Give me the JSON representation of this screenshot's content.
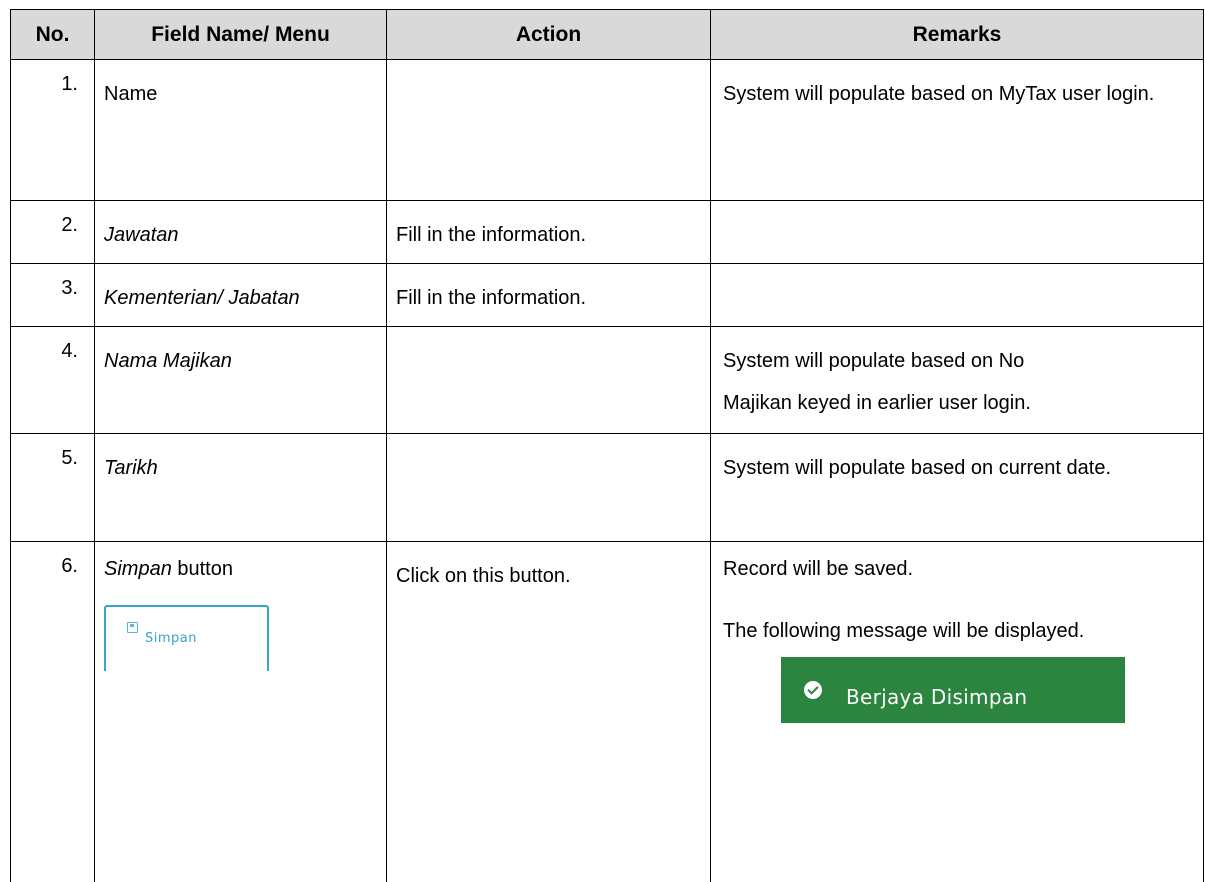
{
  "table": {
    "headers": {
      "no": "No.",
      "field": "Field Name/ Menu",
      "action": "Action",
      "remarks": "Remarks"
    },
    "rows": [
      {
        "no": "1.",
        "field": "Name",
        "action": "",
        "remarks": "System will populate based on MyTax user login."
      },
      {
        "no": "2.",
        "field": "Jawatan",
        "action": "Fill in the information.",
        "remarks": ""
      },
      {
        "no": "3.",
        "field": "Kementerian/ Jabatan",
        "action": "Fill in the information.",
        "remarks": ""
      },
      {
        "no": "4.",
        "field": "Nama Majikan",
        "action": "",
        "remarks_line1": "System will populate based on No",
        "remarks_line2": "Majikan keyed in earlier user login."
      },
      {
        "no": "5.",
        "field": "Tarikh",
        "action": "",
        "remarks": "System will populate based on current date."
      },
      {
        "no": "6.",
        "field_italic": "Simpan",
        "field_suffix": " button",
        "action": "Click on this button.",
        "remarks_line1": "Record will be saved.",
        "remarks_line2": "The following message will be displayed.",
        "button_label": "Simpan",
        "button_icon": "save-icon",
        "message_label": "Berjaya Disimpan",
        "message_icon": "check-circle-icon"
      }
    ]
  },
  "colors": {
    "header_bg": "#d9d9d9",
    "button_accent": "#39a3c9",
    "success_bg": "#2b853f"
  }
}
